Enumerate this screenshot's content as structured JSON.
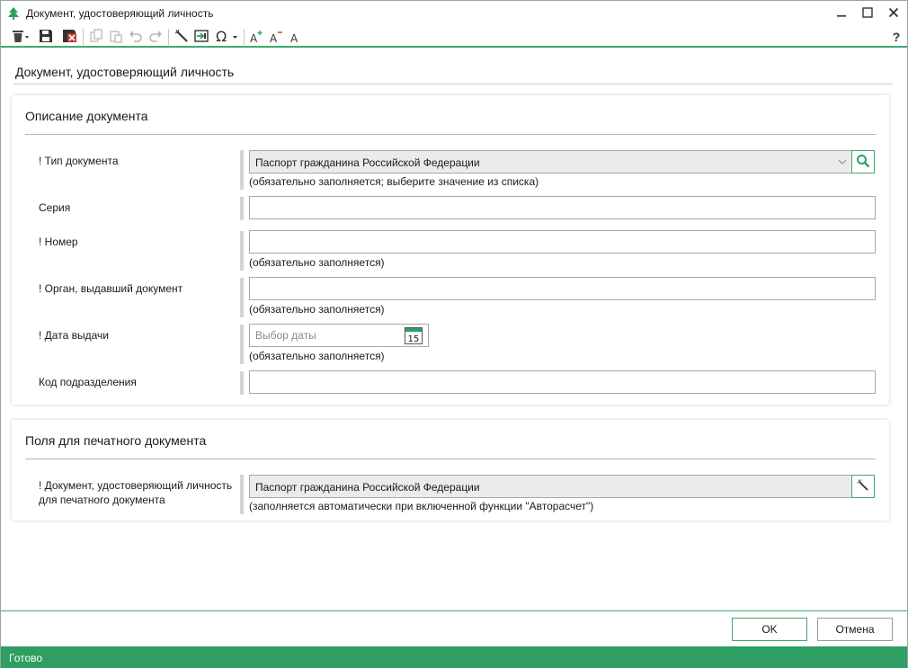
{
  "window": {
    "title": "Документ, удостоверяющий личность",
    "minimize_icon": "minimize-icon",
    "maximize_icon": "maximize-icon",
    "close_icon": "close-icon"
  },
  "toolbar": {
    "help_label": "?",
    "icons": [
      "delete-icon",
      "save-icon",
      "save-close-icon",
      "copy-icon",
      "paste-icon",
      "undo-icon",
      "redo-icon",
      "magic-wand-icon",
      "insert-field-icon",
      "omega-icon",
      "font-increase-icon",
      "font-decrease-icon",
      "font-normal-icon"
    ]
  },
  "page": {
    "title": "Документ, удостоверяющий личность"
  },
  "section_description": {
    "title": "Описание документа",
    "doc_type": {
      "label": "! Тип документа",
      "value": "Паспорт гражданина Российской Федерации",
      "hint": "(обязательно заполняется; выберите значение из списка)"
    },
    "series": {
      "label": "Серия",
      "value": ""
    },
    "number": {
      "label": "! Номер",
      "value": "",
      "hint": "(обязательно заполняется)"
    },
    "issuer": {
      "label": "! Орган, выдавший документ",
      "value": "",
      "hint": "(обязательно заполняется)"
    },
    "issue_date": {
      "label": "! Дата выдачи",
      "placeholder": "Выбор даты",
      "calendar_day": "15",
      "hint": "(обязательно заполняется)"
    },
    "division_code": {
      "label": "Код подразделения",
      "value": ""
    }
  },
  "section_print": {
    "title": "Поля для печатного документа",
    "print_doc": {
      "label_line1": "! Документ, удостоверяющий личность",
      "label_line2": "для печатного документа",
      "value": "Паспорт гражданина Российской Федерации",
      "hint": "(заполняется автоматически при включенной функции \"Авторасчет\")"
    }
  },
  "footer": {
    "ok_label": "OK",
    "cancel_label": "Отмена"
  },
  "status": {
    "text": "Готово"
  },
  "colors": {
    "accent": "#3daa6f",
    "status_bar": "#2e9e63",
    "readonly_field": "#ebebeb"
  }
}
